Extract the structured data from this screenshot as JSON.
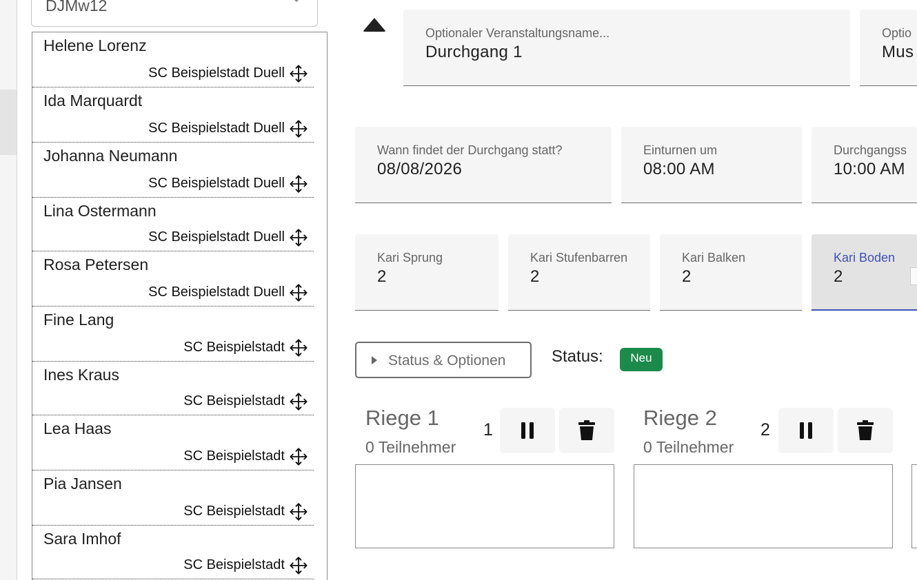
{
  "filter": {
    "selected": "DJMw12"
  },
  "athletes": [
    {
      "name": "Helene Lorenz",
      "club": "SC Beispielstadt Duell"
    },
    {
      "name": "Ida Marquardt",
      "club": "SC Beispielstadt Duell"
    },
    {
      "name": "Johanna Neumann",
      "club": "SC Beispielstadt Duell"
    },
    {
      "name": "Lina Ostermann",
      "club": "SC Beispielstadt Duell"
    },
    {
      "name": "Rosa Petersen",
      "club": "SC Beispielstadt Duell"
    },
    {
      "name": "Fine Lang",
      "club": "SC Beispielstadt"
    },
    {
      "name": "Ines Kraus",
      "club": "SC Beispielstadt"
    },
    {
      "name": "Lea Haas",
      "club": "SC Beispielstadt"
    },
    {
      "name": "Pia Jansen",
      "club": "SC Beispielstadt"
    },
    {
      "name": "Sara Imhof",
      "club": "SC Beispielstadt"
    }
  ],
  "form": {
    "event_name": {
      "label": "Optionaler Veranstaltungsname...",
      "value": "Durchgang 1"
    },
    "location": {
      "label": "Optio",
      "value": "Mus"
    },
    "date": {
      "label": "Wann findet der Durchgang statt?",
      "value": "08/08/2026"
    },
    "warmup": {
      "label": "Einturnen um",
      "value": "08:00 AM"
    },
    "start": {
      "label": "Durchgangss",
      "value": "10:00 AM"
    },
    "kari_sprung": {
      "label": "Kari Sprung",
      "value": "2"
    },
    "kari_stufenbarren": {
      "label": "Kari Stufenbarren",
      "value": "2"
    },
    "kari_balken": {
      "label": "Kari Balken",
      "value": "2"
    },
    "kari_boden": {
      "label": "Kari Boden",
      "value": "2"
    }
  },
  "status": {
    "toggle_label": "Status & Optionen",
    "label": "Status:",
    "badge": "Neu",
    "badge_color": "#1b8a4b"
  },
  "riegen": [
    {
      "title": "Riege 1",
      "count": "0 Teilnehmer",
      "number": "1"
    },
    {
      "title": "Riege 2",
      "count": "0 Teilnehmer",
      "number": "2"
    }
  ],
  "colors": {
    "accent": "#3f51b5"
  },
  "icons": {
    "move": "move-arrows-icon",
    "pause": "pause-icon",
    "delete": "trash-icon",
    "collapse": "caret-up-icon",
    "expand": "caret-right-icon"
  }
}
